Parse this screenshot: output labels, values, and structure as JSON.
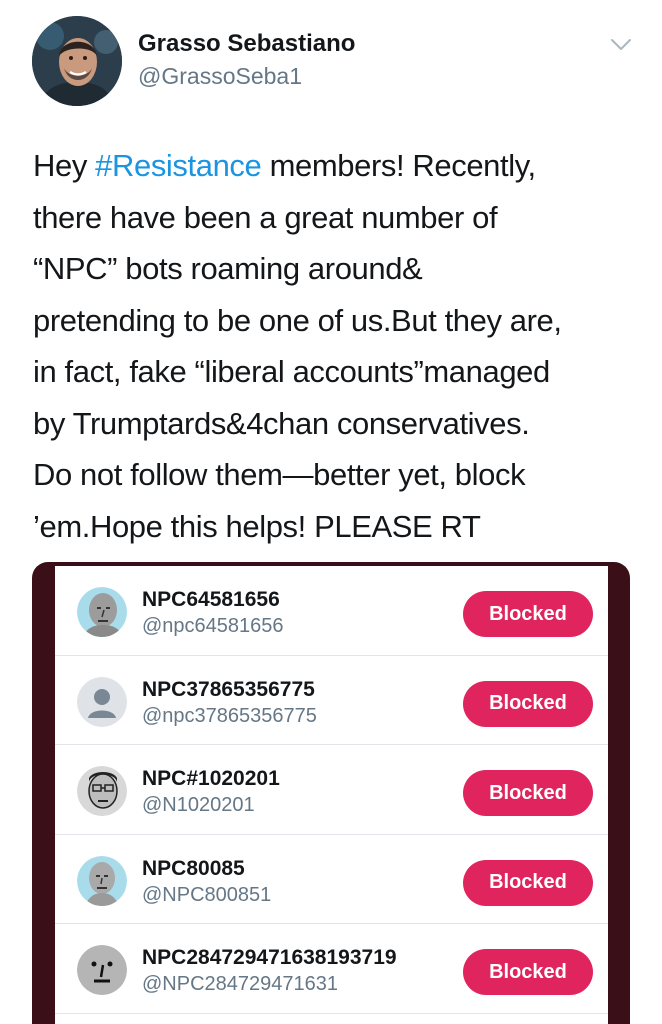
{
  "tweet": {
    "author_name": "Grasso Sebastiano",
    "author_handle": "@GrassoSeba1",
    "menu_icon": "chevron-down-icon",
    "text_before_hashtag": "Hey ",
    "hashtag": "#Resistance",
    "text_after_hashtag": " members! Recently,\nthere have been a great number of\n“NPC” bots roaming around&\npretending to be one of us.But they are,\nin fact, fake “liberal accounts”managed\nby Trumptards&4chan conservatives.\nDo not follow them—better yet, block\n’em.Hope this helps! PLEASE RT"
  },
  "media": {
    "blocked_accounts": [
      {
        "name": "NPC64581656",
        "handle": "@npc64581656",
        "button": "Blocked",
        "avatar": "npc-face-icon"
      },
      {
        "name": "NPC37865356775",
        "handle": "@npc37865356775",
        "button": "Blocked",
        "avatar": "default-user-icon"
      },
      {
        "name": "NPC#1020201",
        "handle": "@N1020201",
        "button": "Blocked",
        "avatar": "npc-glasses-face-icon"
      },
      {
        "name": "NPC80085",
        "handle": "@NPC800851",
        "button": "Blocked",
        "avatar": "npc-face-icon"
      },
      {
        "name": "NPC284729471638193719",
        "handle": "@NPC284729471631",
        "button": "Blocked",
        "avatar": "npc-face-icon"
      }
    ]
  },
  "colors": {
    "hashtag": "#1b95e0",
    "blocked_button": "#e0245e",
    "handle_gray": "#657786",
    "media_frame": "#3a0f18"
  }
}
